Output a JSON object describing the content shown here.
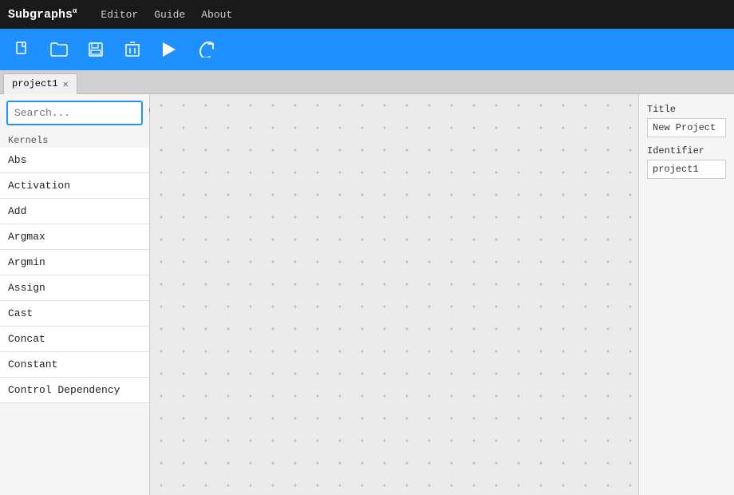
{
  "topNav": {
    "appTitle": "Subgraphs",
    "appTitleSup": "α",
    "items": [
      {
        "label": "Editor",
        "id": "editor"
      },
      {
        "label": "Guide",
        "id": "guide"
      },
      {
        "label": "About",
        "id": "about"
      }
    ]
  },
  "toolbar": {
    "icons": [
      {
        "name": "new-file-icon",
        "glyph": "🗋",
        "unicode": "&#9723;",
        "symbol": "□"
      },
      {
        "name": "folder-icon",
        "glyph": "📂",
        "symbol": "⊡"
      },
      {
        "name": "save-icon",
        "glyph": "💾",
        "symbol": "⊞"
      },
      {
        "name": "delete-icon",
        "glyph": "🗑",
        "symbol": "⊟"
      },
      {
        "name": "play-icon",
        "glyph": "▶",
        "symbol": "▶"
      },
      {
        "name": "redo-icon",
        "glyph": "↪",
        "symbol": "↪"
      }
    ]
  },
  "tabs": [
    {
      "label": "project1",
      "id": "project1",
      "active": true
    }
  ],
  "sidebar": {
    "searchPlaceholder": "Search...",
    "kernelsLabel": "Kernels",
    "kernels": [
      {
        "name": "Abs"
      },
      {
        "name": "Activation"
      },
      {
        "name": "Add"
      },
      {
        "name": "Argmax"
      },
      {
        "name": "Argmin"
      },
      {
        "name": "Assign"
      },
      {
        "name": "Cast"
      },
      {
        "name": "Concat"
      },
      {
        "name": "Constant"
      },
      {
        "name": "Control Dependency"
      }
    ]
  },
  "properties": {
    "titleLabel": "Title",
    "titleValue": "New Project",
    "identifierLabel": "Identifier",
    "identifierValue": "project1"
  },
  "canvas": {
    "dotColor": "#cccccc",
    "dotSpacing": 28
  }
}
